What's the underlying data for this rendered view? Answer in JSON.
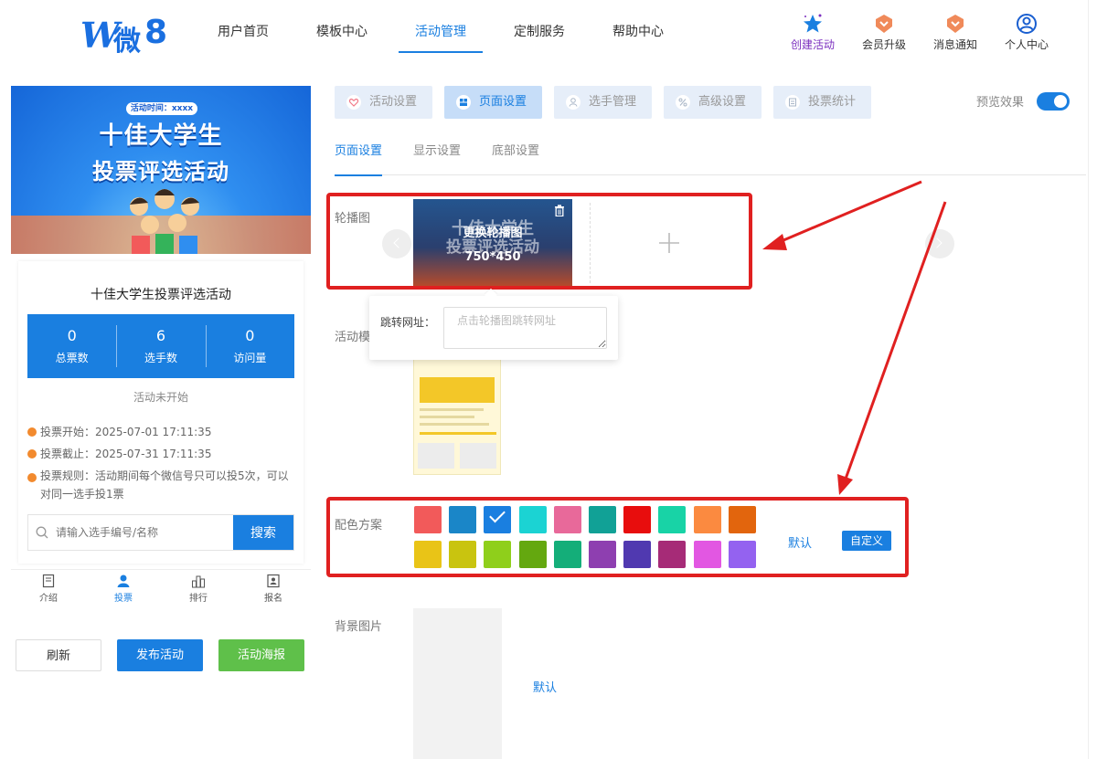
{
  "brand": {
    "logo_w": "W",
    "logo_wei": "微",
    "logo_num": "8"
  },
  "nav": [
    {
      "label": "用户首页"
    },
    {
      "label": "模板中心"
    },
    {
      "label": "活动管理"
    },
    {
      "label": "定制服务"
    },
    {
      "label": "帮助中心"
    }
  ],
  "nav_active": "活动管理",
  "tools": [
    {
      "label": "创建活动",
      "icon": "star-icon"
    },
    {
      "label": "会员升级",
      "icon": "vip-badge-icon"
    },
    {
      "label": "消息通知",
      "icon": "notice-badge-icon"
    },
    {
      "label": "个人中心",
      "icon": "user-circle-icon"
    }
  ],
  "preview": {
    "banner_time": "活动时间：xxxx",
    "banner_title1": "十佳大学生",
    "banner_title2": "投票评选活动",
    "title": "十佳大学生投票评选活动",
    "stats": [
      {
        "value": "0",
        "label": "总票数"
      },
      {
        "value": "6",
        "label": "选手数"
      },
      {
        "value": "0",
        "label": "访问量"
      }
    ],
    "status": "活动未开始",
    "vote_start": "投票开始：2025-07-01 17:11:35",
    "vote_end": "投票截止：2025-07-31 17:11:35",
    "vote_rule": "投票规则：活动期间每个微信号只可以投5次，可以对同一选手投1票",
    "search_placeholder": "请输入选手编号/名称",
    "search_button": "搜索",
    "tabbar": [
      {
        "label": "介绍",
        "icon": "document-icon"
      },
      {
        "label": "投票",
        "icon": "person-icon"
      },
      {
        "label": "排行",
        "icon": "ranking-icon"
      },
      {
        "label": "报名",
        "icon": "signup-icon"
      }
    ]
  },
  "actions": {
    "refresh": "刷新",
    "publish": "发布活动",
    "poster": "活动海报"
  },
  "settings_tabs": [
    {
      "label": "活动设置",
      "icon": "heart-icon"
    },
    {
      "label": "页面设置",
      "icon": "layout-icon"
    },
    {
      "label": "选手管理",
      "icon": "contestant-icon"
    },
    {
      "label": "高级设置",
      "icon": "percent-icon"
    },
    {
      "label": "投票统计",
      "icon": "stats-icon"
    }
  ],
  "settings_tab_active": "页面设置",
  "preview_toggle_label": "预览效果",
  "preview_toggle_on": true,
  "subtabs": [
    {
      "label": "页面设置"
    },
    {
      "label": "显示设置"
    },
    {
      "label": "底部设置"
    }
  ],
  "sections": {
    "carousel_label": "轮播图",
    "carousel_replace": "更换轮播图",
    "carousel_size": "750*450",
    "carousel_ghost1": "十佳大学生",
    "carousel_ghost2": "投票评选活动",
    "jump_label": "跳转网址：",
    "jump_placeholder": "点击轮播图跳转网址",
    "template_label": "活动模",
    "color_label": "配色方案",
    "color_default": "默认",
    "color_custom": "自定义",
    "bg_label": "背景图片",
    "bg_default": "默认"
  },
  "palette": [
    "#f25a5a",
    "#1a86c8",
    "#1a7fe0",
    "#1bd3d3",
    "#e8699a",
    "#11a196",
    "#e80d0d",
    "#18d3a6",
    "#fb8a40",
    "#e2650d",
    "#e9c417",
    "#c9c40f",
    "#8fcf1b",
    "#64a80f",
    "#14ae79",
    "#8e3fb0",
    "#5039b0",
    "#a62b77",
    "#e257e2",
    "#9462f0"
  ],
  "palette_selected_index": 2
}
